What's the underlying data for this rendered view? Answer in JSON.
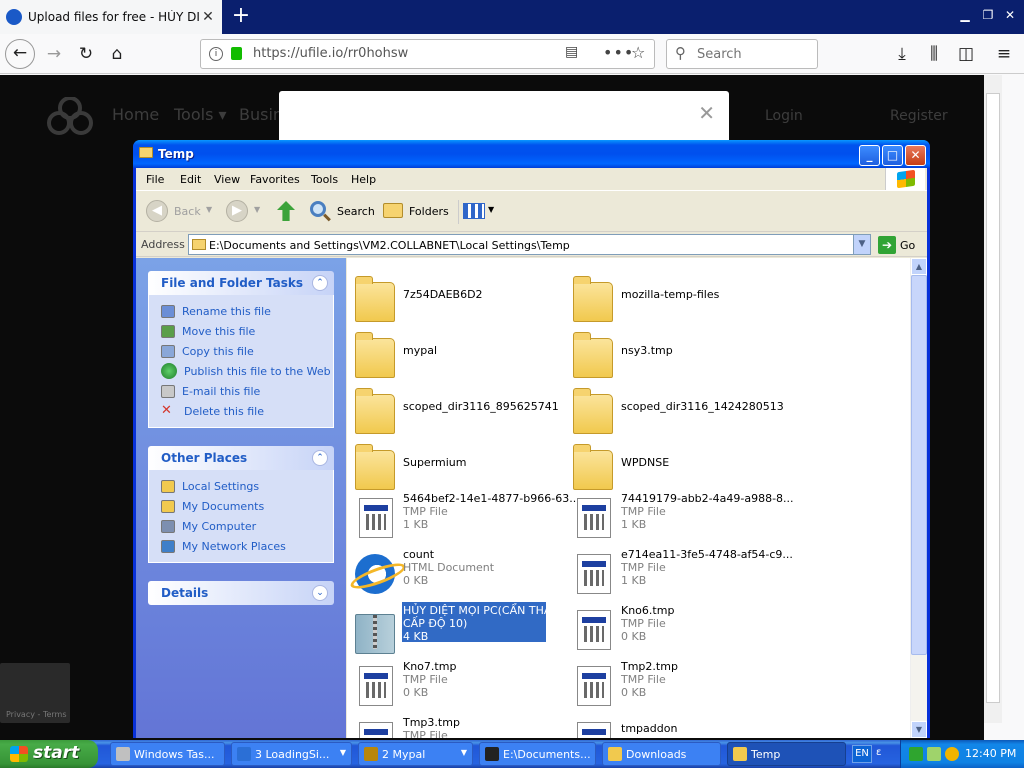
{
  "browser": {
    "tab_title": "Upload files for free - HỦY DIỆT M",
    "tab_close": "✕",
    "new_tab": "+",
    "url": "https://ufile.io/rr0hohsw",
    "search_placeholder": "Search",
    "page_actions": "•••"
  },
  "site": {
    "nav": [
      "Home",
      "Tools ▾",
      "Busin"
    ],
    "login": "Login",
    "register": "Register",
    "modal_close": "✕",
    "recaptcha_label": "Privacy - Terms"
  },
  "explorer": {
    "title": "Temp",
    "menu": [
      "File",
      "Edit",
      "View",
      "Favorites",
      "Tools",
      "Help"
    ],
    "toolbar": {
      "back": "Back",
      "search": "Search",
      "folders": "Folders"
    },
    "address_label": "Address",
    "address_value": "E:\\Documents and Settings\\VM2.COLLABNET\\Local Settings\\Temp",
    "go_label": "Go",
    "panels": {
      "file_tasks": {
        "title": "File and Folder Tasks",
        "items": [
          {
            "label": "Rename this file",
            "icon": "rename-icon"
          },
          {
            "label": "Move this file",
            "icon": "move-icon"
          },
          {
            "label": "Copy this file",
            "icon": "copy-icon"
          },
          {
            "label": "Publish this file to the Web",
            "icon": "globe-icon"
          },
          {
            "label": "E-mail this file",
            "icon": "email-icon"
          },
          {
            "label": "Delete this file",
            "icon": "delete-icon"
          }
        ]
      },
      "other_places": {
        "title": "Other Places",
        "items": [
          {
            "label": "Local Settings",
            "icon": "folder-icon"
          },
          {
            "label": "My Documents",
            "icon": "my-documents-icon"
          },
          {
            "label": "My Computer",
            "icon": "my-computer-icon"
          },
          {
            "label": "My Network Places",
            "icon": "network-places-icon"
          }
        ]
      },
      "details": {
        "title": "Details"
      }
    },
    "files": [
      {
        "name": "7z54DAEB6D2",
        "type": "",
        "size": "",
        "kind": "folder"
      },
      {
        "name": "mozilla-temp-files",
        "type": "",
        "size": "",
        "kind": "folder"
      },
      {
        "name": "mypal",
        "type": "",
        "size": "",
        "kind": "folder"
      },
      {
        "name": "nsy3.tmp",
        "type": "",
        "size": "",
        "kind": "folder"
      },
      {
        "name": "scoped_dir3116_895625741",
        "type": "",
        "size": "",
        "kind": "folder"
      },
      {
        "name": "scoped_dir3116_1424280513",
        "type": "",
        "size": "",
        "kind": "folder"
      },
      {
        "name": "Supermium",
        "type": "",
        "size": "",
        "kind": "folder"
      },
      {
        "name": "WPDNSE",
        "type": "",
        "size": "",
        "kind": "folder"
      },
      {
        "name": "5464bef2-14e1-4877-b966-63...",
        "type": "TMP File",
        "size": "1 KB",
        "kind": "file"
      },
      {
        "name": "74419179-abb2-4a49-a988-8...",
        "type": "TMP File",
        "size": "1 KB",
        "kind": "file"
      },
      {
        "name": "count",
        "type": "HTML Document",
        "size": "0 KB",
        "kind": "html"
      },
      {
        "name": "e714ea11-3fe5-4748-af54-c9...",
        "type": "TMP File",
        "size": "1 KB",
        "kind": "file"
      },
      {
        "name": "HỦY DIỆT MỌI PC(CẨN THẬN",
        "name2": "CẤP ĐỘ 10)",
        "type": "",
        "size": "4 KB",
        "kind": "zip",
        "selected": true
      },
      {
        "name": "Kno6.tmp",
        "type": "TMP File",
        "size": "0 KB",
        "kind": "file"
      },
      {
        "name": "Kno7.tmp",
        "type": "TMP File",
        "size": "0 KB",
        "kind": "file"
      },
      {
        "name": "Tmp2.tmp",
        "type": "TMP File",
        "size": "0 KB",
        "kind": "file"
      },
      {
        "name": "Tmp3.tmp",
        "type": "TMP File",
        "size": "",
        "kind": "file"
      },
      {
        "name": "tmpaddon",
        "type": "",
        "size": "",
        "kind": "file"
      }
    ]
  },
  "taskbar": {
    "start": "start",
    "buttons": [
      {
        "label": "Windows Tas...",
        "dropdown": false
      },
      {
        "label": "3 LoadingSi...",
        "dropdown": true
      },
      {
        "label": "2 Mypal",
        "dropdown": true
      },
      {
        "label": "E:\\Documents...",
        "dropdown": false
      },
      {
        "label": "Downloads",
        "dropdown": false
      },
      {
        "label": "Temp",
        "dropdown": false,
        "active": true
      }
    ],
    "lang": "EN",
    "lang2": "ε",
    "clock": "12:40 PM"
  },
  "colors": {
    "xp_blue": "#0831d9",
    "selection": "#316ac5",
    "task_link": "#215dc6",
    "start_green": "#3c9c3c"
  }
}
